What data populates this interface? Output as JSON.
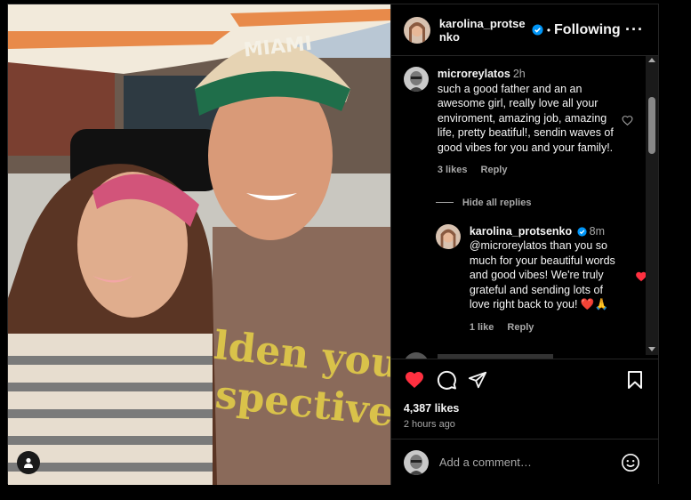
{
  "post": {
    "author": "karolina_protsenko",
    "author_verified": true,
    "follow_status": "Following",
    "likes": "4,387 likes",
    "posted_ago": "2 hours ago"
  },
  "comments": [
    {
      "user": "microreylatos",
      "time": "2h",
      "text": "such a good father and an an awesome girl, really love all your enviroment, amazing job, amazing life, pretty beatiful!, sendin waves of good vibes for you and your family!.",
      "likes": "3 likes",
      "reply_label": "Reply"
    }
  ],
  "hide_replies_label": "Hide all replies",
  "replies": [
    {
      "user": "karolina_protsenko",
      "time": "8m",
      "text": "@microreylatos than you so much for your beautiful words and good vibes! We're truly grateful and sending lots of love right back to you! ❤️🙏",
      "likes": "1 like",
      "reply_label": "Reply"
    }
  ],
  "add_comment": {
    "placeholder": "Add a comment…"
  },
  "photo": {
    "shirt_text_line1": "lden your",
    "shirt_text_line2": "spective",
    "cap_text": "MIAMI"
  },
  "colors": {
    "accent_red": "#ff3040",
    "verified_blue": "#0095f6",
    "muted": "#a8a8a8"
  }
}
